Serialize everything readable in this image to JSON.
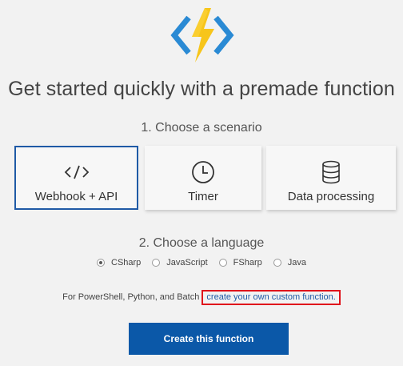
{
  "header": {
    "logo_icon": "azure-functions-bolt-icon",
    "title": "Get started quickly with a premade function"
  },
  "scenario": {
    "step_label": "1. Choose a scenario",
    "options": [
      {
        "label": "Webhook + API",
        "icon": "code-brackets-icon",
        "selected": true
      },
      {
        "label": "Timer",
        "icon": "clock-icon",
        "selected": false
      },
      {
        "label": "Data processing",
        "icon": "database-icon",
        "selected": false
      }
    ]
  },
  "language": {
    "step_label": "2. Choose a language",
    "options": [
      {
        "label": "CSharp",
        "checked": true
      },
      {
        "label": "JavaScript",
        "checked": false
      },
      {
        "label": "FSharp",
        "checked": false
      },
      {
        "label": "Java",
        "checked": false
      }
    ]
  },
  "custom": {
    "prefix": "For PowerShell, Python, and Batch",
    "link": "create your own custom function."
  },
  "actions": {
    "create_label": "Create this function"
  },
  "colors": {
    "accent": "#0b58a8",
    "selected_border": "#1f5aa6",
    "highlight_box": "#e0141c",
    "bolt_yellow": "#f7c51a",
    "chevron_blue": "#2a8ad4"
  }
}
